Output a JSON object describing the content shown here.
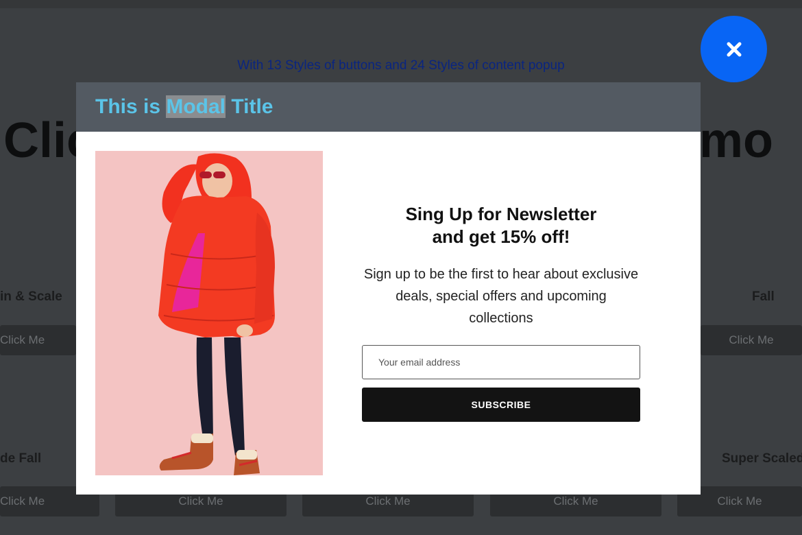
{
  "background": {
    "subtitle": "With 13 Styles of buttons and 24 Styles of content popup",
    "hero_left": "Clic",
    "hero_right": "mo",
    "labels": [
      "in & Scale",
      "Fall",
      "de Fall",
      "Super Scaled"
    ],
    "button_label": "Click Me"
  },
  "modal": {
    "title_before": "This is ",
    "title_highlight": "Modal",
    "title_after": " Title",
    "image_icon": "woman-red-jacket-photo",
    "heading_line1": "Sing Up for Newsletter",
    "heading_line2": "and get 15% off!",
    "description": "Sign up to be the first to hear about exclusive deals, special offers and upcoming collections",
    "email_placeholder": "Your email address",
    "subscribe_label": "SUBSCRIBE"
  },
  "close_icon": "close-icon",
  "colors": {
    "accent_blue": "#0865f5",
    "title_color": "#5bc4e8",
    "header_bg": "#535a62"
  }
}
